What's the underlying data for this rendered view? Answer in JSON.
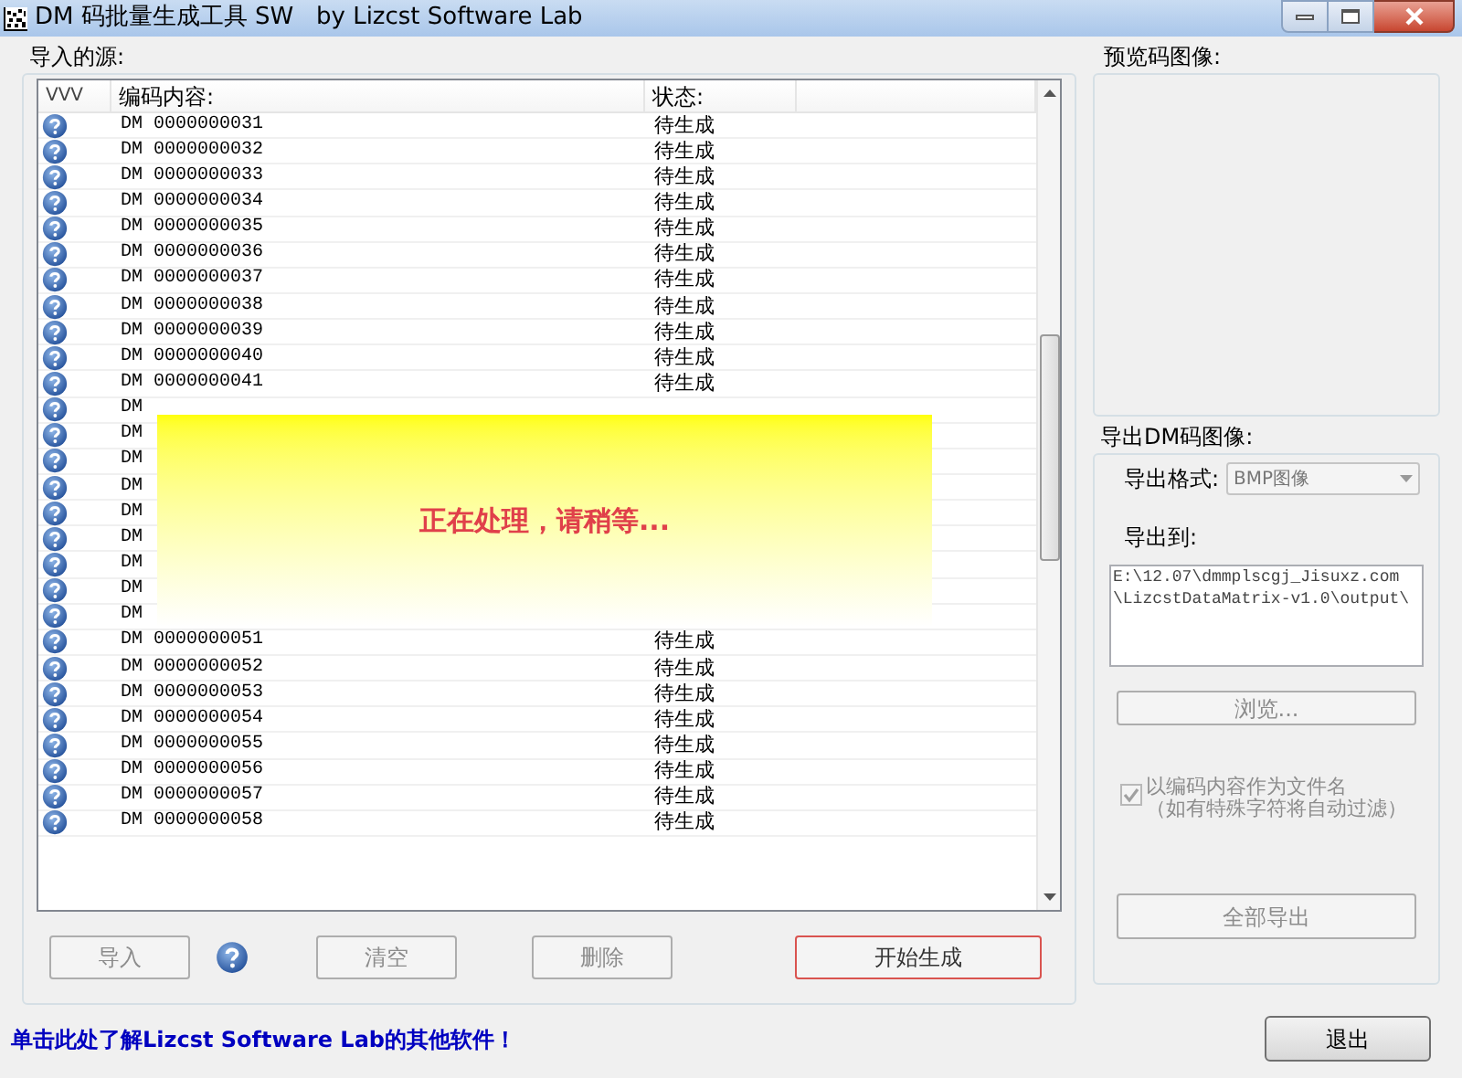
{
  "window": {
    "title": "DM 码批量生成工具 SW   by Lizcst Software Lab"
  },
  "source": {
    "label": "导入的源:",
    "columns": [
      "VVV",
      "编码内容:",
      "状态:"
    ],
    "rows": [
      {
        "code": "DM 0000000031",
        "status": "待生成"
      },
      {
        "code": "DM 0000000032",
        "status": "待生成"
      },
      {
        "code": "DM 0000000033",
        "status": "待生成"
      },
      {
        "code": "DM 0000000034",
        "status": "待生成"
      },
      {
        "code": "DM 0000000035",
        "status": "待生成"
      },
      {
        "code": "DM 0000000036",
        "status": "待生成"
      },
      {
        "code": "DM 0000000037",
        "status": "待生成"
      },
      {
        "code": "DM 0000000038",
        "status": "待生成"
      },
      {
        "code": "DM 0000000039",
        "status": "待生成"
      },
      {
        "code": "DM 0000000040",
        "status": "待生成"
      },
      {
        "code": "DM 0000000041",
        "status": "待生成"
      },
      {
        "code": "DM"
      },
      {
        "code": "DM"
      },
      {
        "code": "DM"
      },
      {
        "code": "DM"
      },
      {
        "code": "DM"
      },
      {
        "code": "DM"
      },
      {
        "code": "DM"
      },
      {
        "code": "DM"
      },
      {
        "code": "DM"
      },
      {
        "code": "DM 0000000051",
        "status": "待生成"
      },
      {
        "code": "DM 0000000052",
        "status": "待生成"
      },
      {
        "code": "DM 0000000053",
        "status": "待生成"
      },
      {
        "code": "DM 0000000054",
        "status": "待生成"
      },
      {
        "code": "DM 0000000055",
        "status": "待生成"
      },
      {
        "code": "DM 0000000056",
        "status": "待生成"
      },
      {
        "code": "DM 0000000057",
        "status": "待生成"
      },
      {
        "code": "DM 0000000058",
        "status": "待生成"
      }
    ],
    "buttons": [
      {
        "kind": "button",
        "label": "导入",
        "disabled": true,
        "focused": false
      },
      {
        "kind": "help"
      },
      {
        "kind": "button",
        "label": "清空",
        "disabled": true,
        "focused": false
      },
      {
        "kind": "button",
        "label": "删除",
        "disabled": true,
        "focused": false
      },
      {
        "kind": "button",
        "label": "开始生成",
        "disabled": false,
        "focused": true
      }
    ]
  },
  "overlay": {
    "message": "正在处理，请稍等..."
  },
  "preview": {
    "label": "预览码图像:"
  },
  "export": {
    "label": "导出DM码图像:",
    "format_label": "导出格式:",
    "format_value": "BMP图像",
    "target_label": "导出到:",
    "target_value": "E:\\12.07\\dmmplscgj_Jisuxz.com\n\\LizcstDataMatrix-v1.0\\output\\",
    "browse": {
      "label": "浏览...",
      "disabled": true
    },
    "filename_option": {
      "label": "以编码内容作为文件名",
      "note": "（如有特殊字符将自动过滤）",
      "checked": true,
      "disabled": true
    },
    "export_all": {
      "label": "全部导出",
      "disabled": true
    }
  },
  "footer": {
    "link": "单击此处了解Lizcst Software Lab的其他软件！",
    "exit": "退出"
  }
}
